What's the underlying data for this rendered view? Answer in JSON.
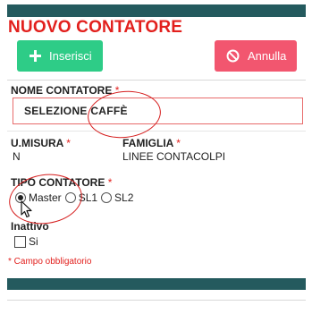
{
  "title": "NUOVO CONTATORE",
  "buttons": {
    "insert_label": "Inserisci",
    "cancel_label": "Annulla"
  },
  "fields": {
    "nome_label": "NOME CONTATORE",
    "nome_value": "SELEZIONE CAFFÈ",
    "umisura_label": "U.MISURA",
    "umisura_value": "N",
    "famiglia_label": "FAMIGLIA",
    "famiglia_value": "LINEE CONTACOLPI",
    "tipo_label": "TIPO CONTATORE",
    "tipo_options": [
      "Master",
      "SL1",
      "SL2"
    ],
    "tipo_selected": "Master",
    "inattivo_label": "Inattivo",
    "inattivo_option": "Si"
  },
  "required_marker": "*",
  "required_note": "* Campo obbligatorio",
  "colors": {
    "brand_bar": "#245a5e",
    "title": "#e2201d",
    "insert": "#2ecc87",
    "cancel": "#f2566f",
    "annotation": "#d51c1c"
  },
  "icons": {
    "insert": "plus-icon",
    "cancel": "ban-icon",
    "pointer": "mouse-cursor-icon"
  }
}
